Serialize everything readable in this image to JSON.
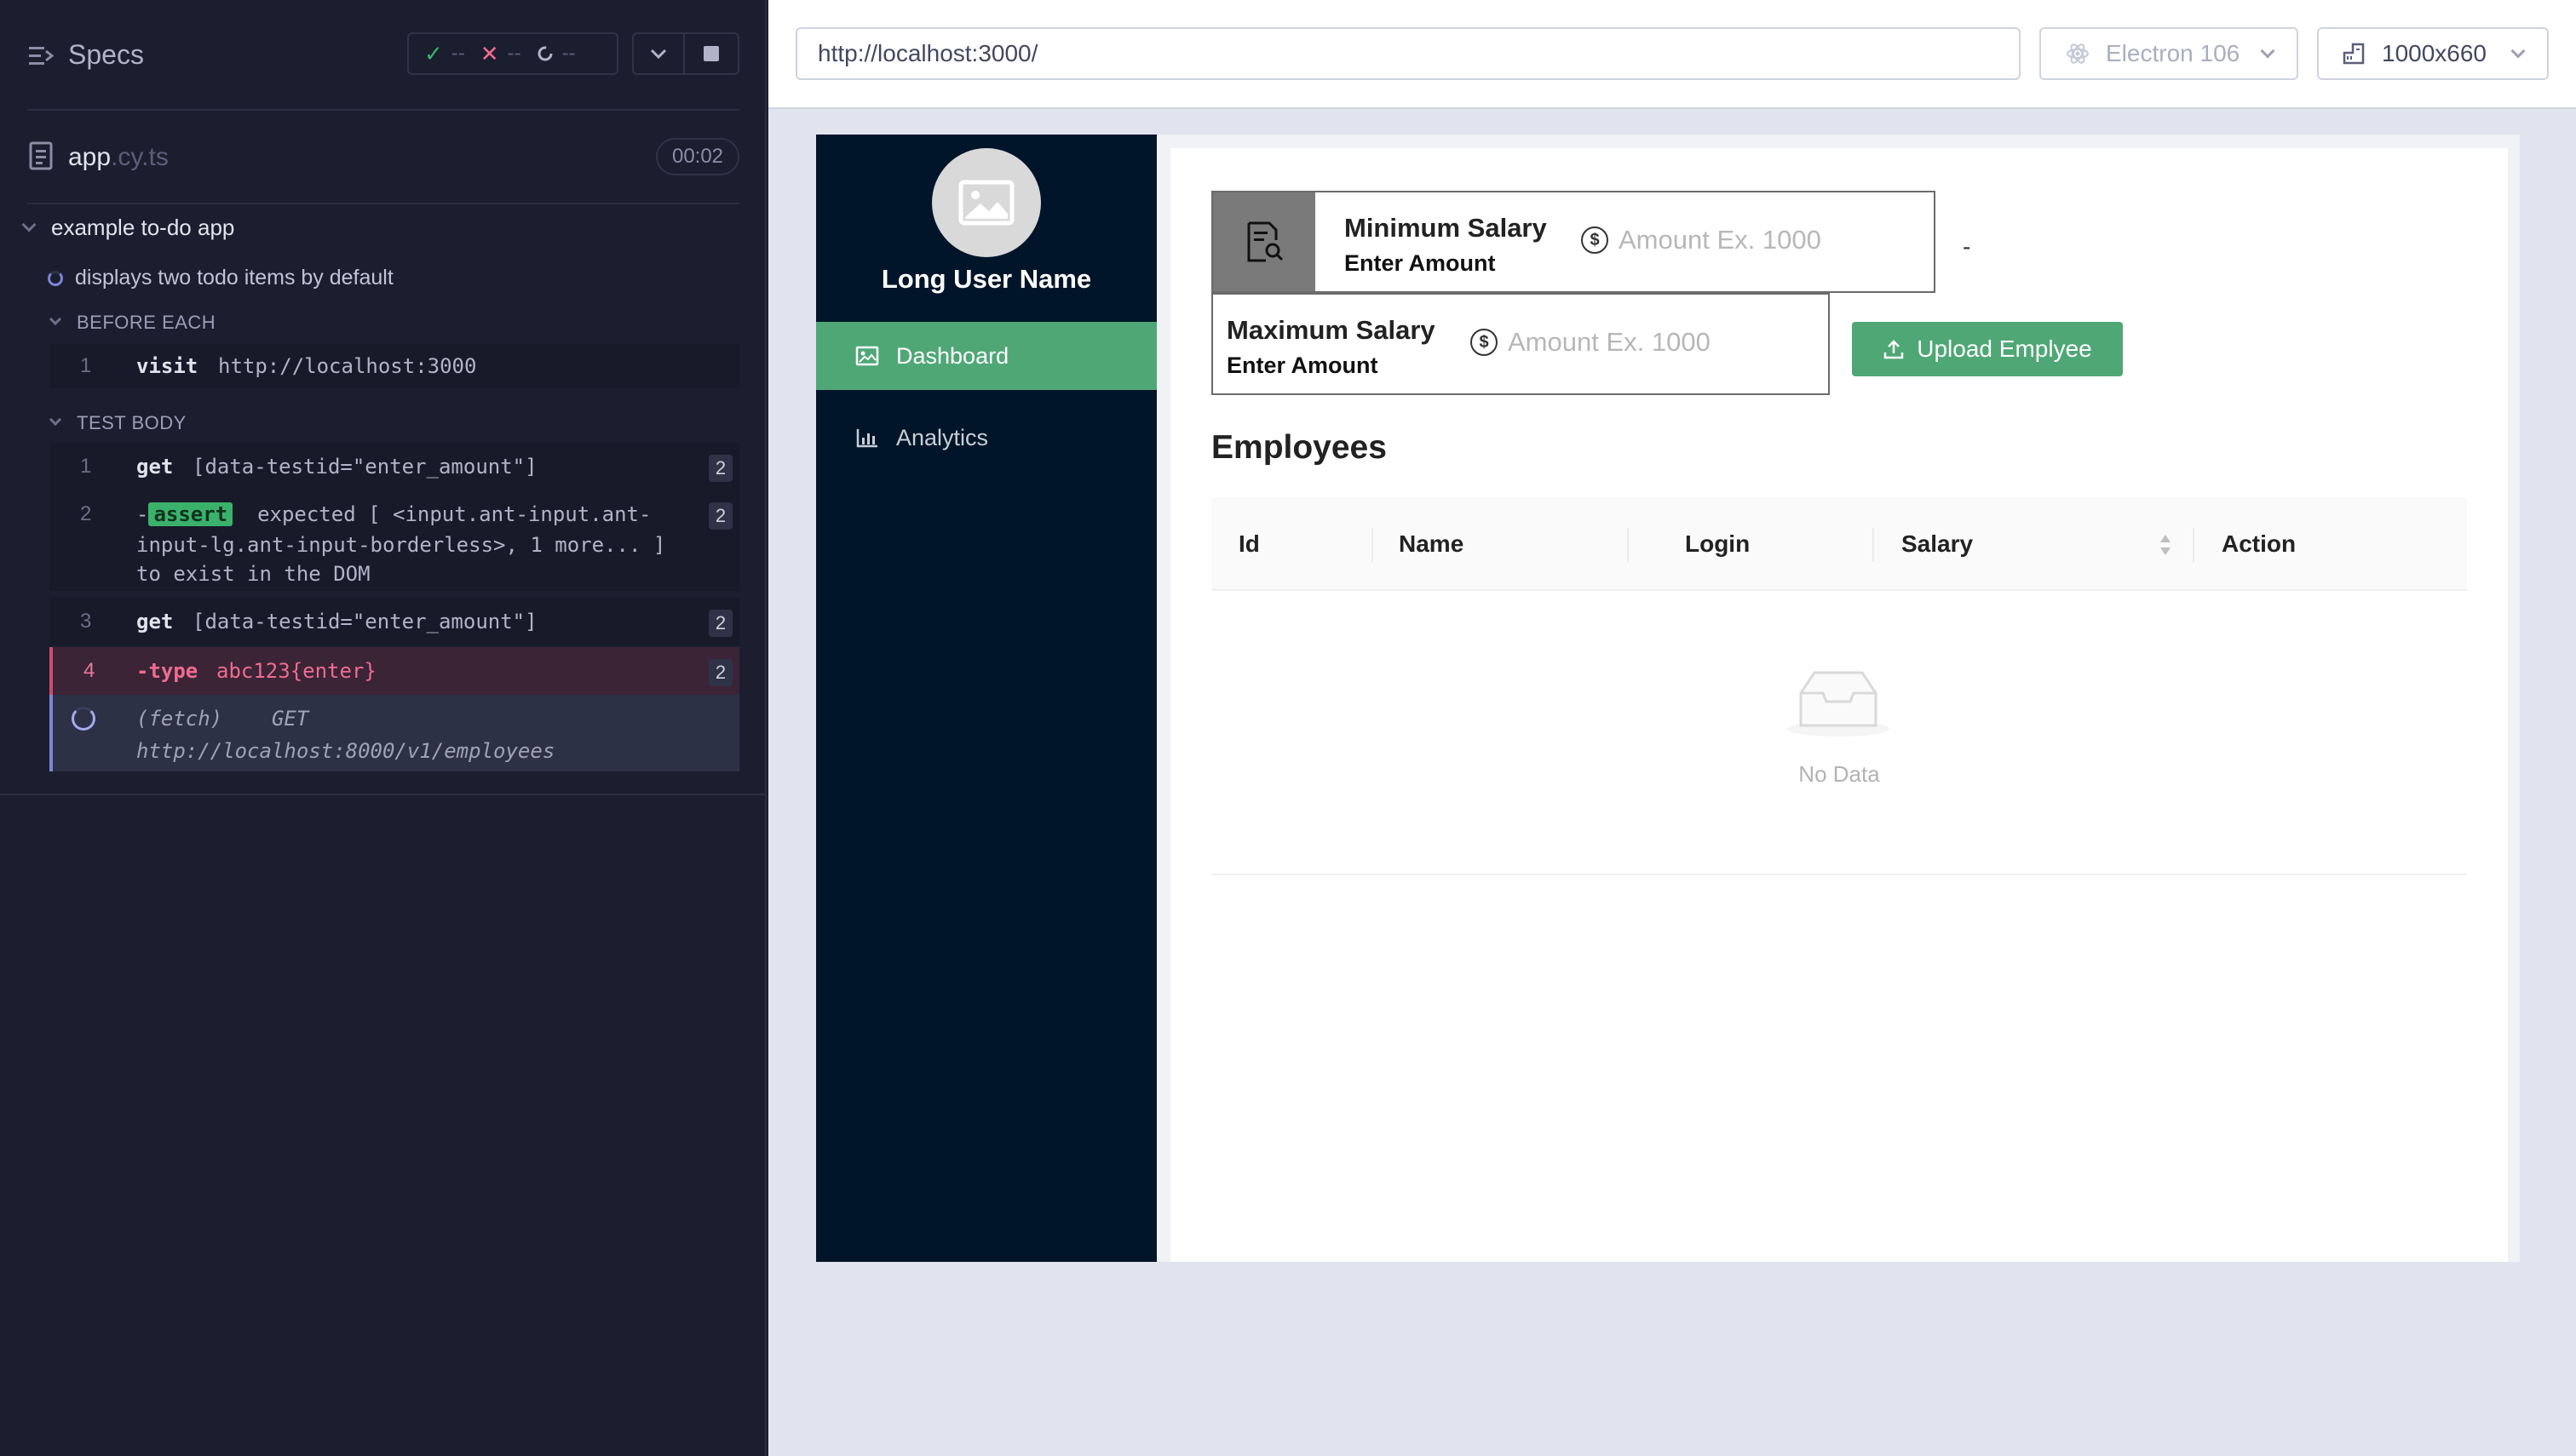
{
  "runner": {
    "specs_title": "Specs",
    "stats": {
      "passed": "--",
      "failed": "--",
      "pending": "--"
    },
    "file": {
      "name": "app",
      "ext": ".cy.ts",
      "timer": "00:02"
    },
    "suite": "example to-do app",
    "test": "displays two todo items by default",
    "before_each_label": "BEFORE EACH",
    "test_body_label": "TEST BODY",
    "before_each": [
      {
        "num": "1",
        "name": "visit",
        "message": "http://localhost:3000"
      }
    ],
    "commands": [
      {
        "num": "1",
        "name": "get",
        "message": "[data-testid=\"enter_amount\"]",
        "badge": "2"
      },
      {
        "num": "2",
        "prefix": "-",
        "tag": "assert",
        "line1": "expected [ <input.ant-input.ant-",
        "line2": "input-lg.ant-input-borderless>, 1 more... ]",
        "line3": "to exist in the DOM",
        "badge": "2"
      },
      {
        "num": "3",
        "name": "get",
        "message": "[data-testid=\"enter_amount\"]",
        "badge": "2"
      },
      {
        "num": "4",
        "name": "-type",
        "message": "abc123{enter}",
        "badge": "2"
      }
    ],
    "fetch": {
      "method_line": "(fetch)    GET",
      "url": "http://localhost:8000/v1/employees"
    }
  },
  "toolbar": {
    "url": "http://localhost:3000/",
    "browser": "Electron 106",
    "viewport": "1000x660"
  },
  "app": {
    "user_name": "Long User Name",
    "menu": [
      {
        "label": "Dashboard",
        "icon": "picture-icon",
        "active": true
      },
      {
        "label": "Analytics",
        "icon": "bar-chart-icon",
        "active": false
      }
    ],
    "min_salary": {
      "label": "Minimum Salary",
      "sub": "Enter Amount",
      "placeholder": "Amount Ex. 1000"
    },
    "max_salary": {
      "label": "Maximum Salary",
      "sub": "Enter Amount",
      "placeholder": "Amount Ex. 1000"
    },
    "separator": "-",
    "upload_label": "Upload Emplyee",
    "employees_title": "Employees",
    "columns": [
      "Id",
      "Name",
      "Login",
      "Salary",
      "Action"
    ],
    "empty_text": "No Data"
  },
  "colors": {
    "runner_bg": "#1b1e2e",
    "sider_bg": "#001529",
    "accent_green": "#4fa776",
    "error_pink": "#f06b8f",
    "assert_green": "#3bb26b"
  }
}
